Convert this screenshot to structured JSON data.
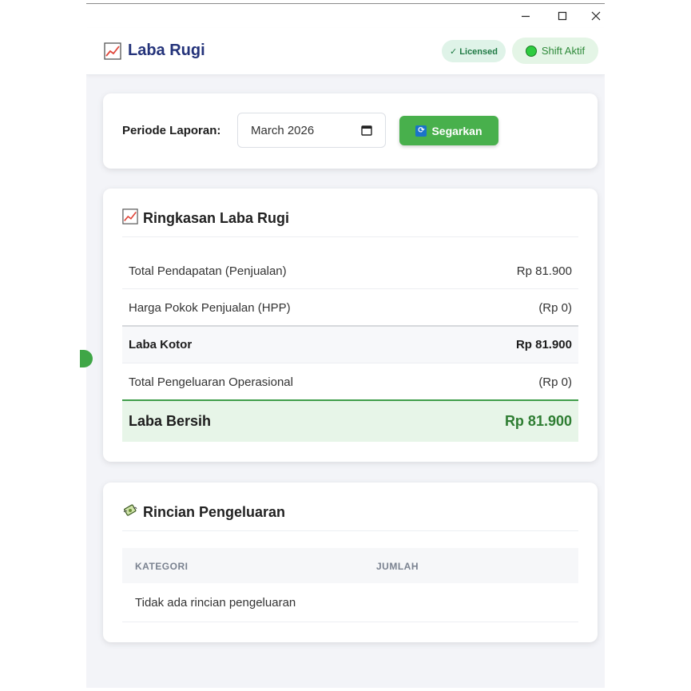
{
  "header": {
    "title": "Laba Rugi",
    "badges": {
      "licensed": "✓ Licensed",
      "shift": "Shift Aktif"
    }
  },
  "filter": {
    "period_label": "Periode Laporan:",
    "period_value": "March 2026",
    "refresh_label": "Segarkan"
  },
  "summary": {
    "title": "Ringkasan Laba Rugi",
    "rows": [
      {
        "label": "Total Pendapatan (Penjualan)",
        "value": "Rp 81.900"
      },
      {
        "label": "Harga Pokok Penjualan (HPP)",
        "value": "(Rp 0)"
      },
      {
        "label": "Laba Kotor",
        "value": "Rp 81.900"
      },
      {
        "label": "Total Pengeluaran Operasional",
        "value": "(Rp 0)"
      },
      {
        "label": "Laba Bersih",
        "value": "Rp 81.900"
      }
    ]
  },
  "expenses": {
    "title": "Rincian Pengeluaran",
    "columns": [
      "KATEGORI",
      "JUMLAH"
    ],
    "empty_text": "Tidak ada rincian pengeluaran"
  },
  "colors": {
    "accent_green": "#48b04c",
    "net_profit_green": "#2e7d32",
    "title_navy": "#24337a"
  }
}
